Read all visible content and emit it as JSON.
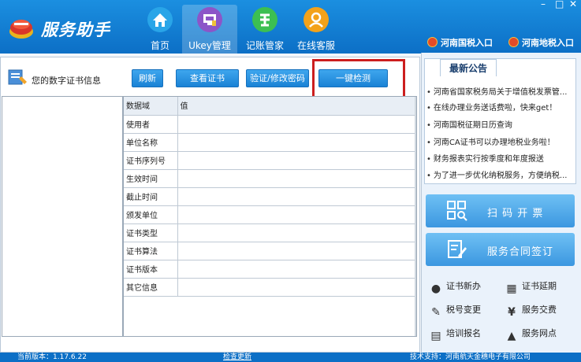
{
  "app": {
    "title": "服务助手",
    "window_controls": [
      "–",
      "□",
      "✕"
    ]
  },
  "nav": [
    {
      "label": "首页",
      "icon": "home-icon",
      "color": "#29a5e8"
    },
    {
      "label": "Ukey管理",
      "icon": "ukey-monitor-icon",
      "color": "#8c55c8"
    },
    {
      "label": "记账管家",
      "icon": "tax-badge-icon",
      "color": "#3cbf52"
    },
    {
      "label": "在线客服",
      "icon": "person-icon",
      "color": "#f3a21a"
    }
  ],
  "tax_links": {
    "national": "河南国税入口",
    "local": "河南地税入口"
  },
  "cert": {
    "title": "您的数字证书信息"
  },
  "toolbar": {
    "refresh": "刷新",
    "view_cert": "查看证书",
    "verify_password": "验证/修改密码",
    "one_click_check": "一键检测"
  },
  "grid": {
    "headers": [
      "数据域",
      "值"
    ],
    "rows": [
      {
        "field": "使用者",
        "value": ""
      },
      {
        "field": "单位名称",
        "value": ""
      },
      {
        "field": "证书序列号",
        "value": ""
      },
      {
        "field": "生效时间",
        "value": ""
      },
      {
        "field": "截止时间",
        "value": ""
      },
      {
        "field": "颁发单位",
        "value": ""
      },
      {
        "field": "证书类型",
        "value": ""
      },
      {
        "field": "证书算法",
        "value": ""
      },
      {
        "field": "证书版本",
        "value": ""
      },
      {
        "field": "其它信息",
        "value": ""
      }
    ]
  },
  "notices": {
    "tab": "最新公告",
    "items": [
      "河南省国家税务局关于增值税发票管...",
      "在线办理业务送话费啦，快来get！",
      "河南国税征期日历查询",
      "河南CA证书可以办理地税业务啦！",
      "财务报表实行按季度和年度报送",
      "为了进一步优化纳税服务，方便纳税..."
    ]
  },
  "actions": {
    "scan": "扫 码 开 票",
    "contract": "服务合同签订"
  },
  "services": [
    {
      "label": "证书新办",
      "icon": "user-add-icon"
    },
    {
      "label": "证书延期",
      "icon": "calendar-icon"
    },
    {
      "label": "税号变更",
      "icon": "tax-change-icon"
    },
    {
      "label": "服务交费",
      "icon": "yen-icon"
    },
    {
      "label": "培训报名",
      "icon": "book-icon"
    },
    {
      "label": "服务网点",
      "icon": "outlets-icon"
    }
  ],
  "status": {
    "version": "当前版本：1.17.6.22",
    "check_update": "检查更新",
    "support": "技术支持：河南航天金穗电子有限公司"
  }
}
